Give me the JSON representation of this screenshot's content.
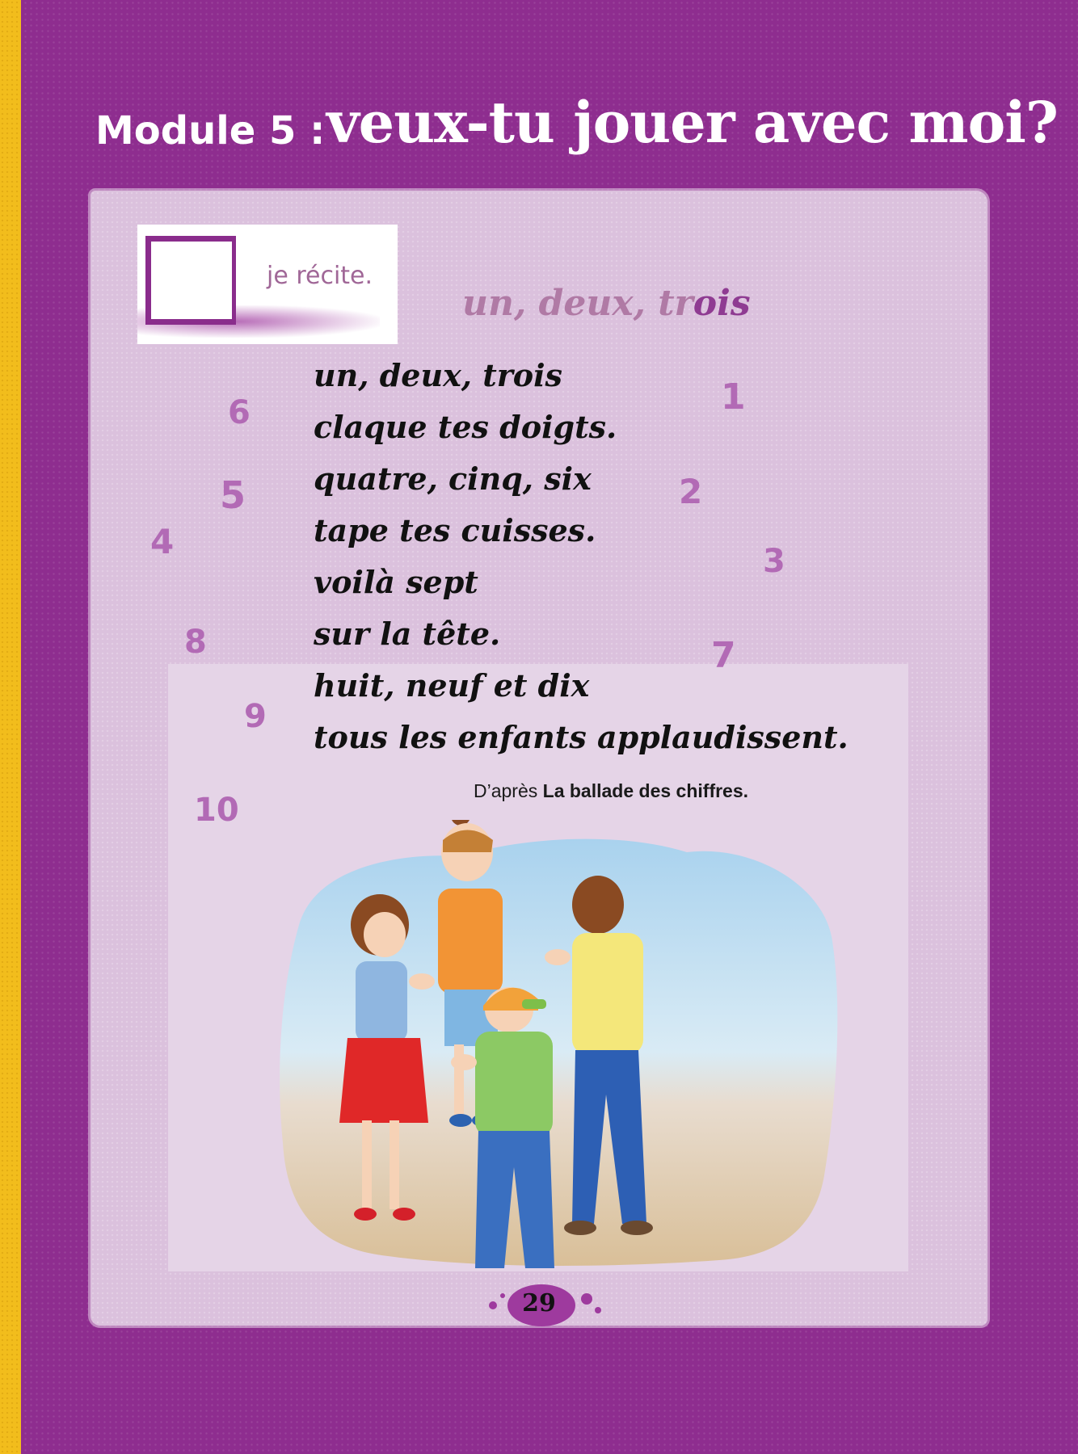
{
  "header": {
    "module": "Module 5 :",
    "title": "veux-tu jouer avec moi?"
  },
  "section": {
    "badge_label": "je récite.",
    "poem_title_main": "un, deux, tr",
    "poem_title_accent": "ois"
  },
  "poem": {
    "lines": [
      "un, deux, trois",
      "claque tes doigts.",
      "quatre, cinq, six",
      "tape tes cuisses.",
      "voilà sept",
      "sur la tête.",
      "huit, neuf et dix",
      "tous les enfants applaudissent."
    ],
    "credit_prefix": "D’après ",
    "credit_source": "La ballade des chiffres."
  },
  "numbers": [
    "1",
    "2",
    "3",
    "4",
    "5",
    "6",
    "7",
    "8",
    "9",
    "10"
  ],
  "footer": {
    "page_number": "29"
  },
  "colors": {
    "background": "#8e2d8f",
    "spine": "#f2bd1c",
    "panel": "#dbc1dd",
    "numbers": "#b26ab5"
  }
}
